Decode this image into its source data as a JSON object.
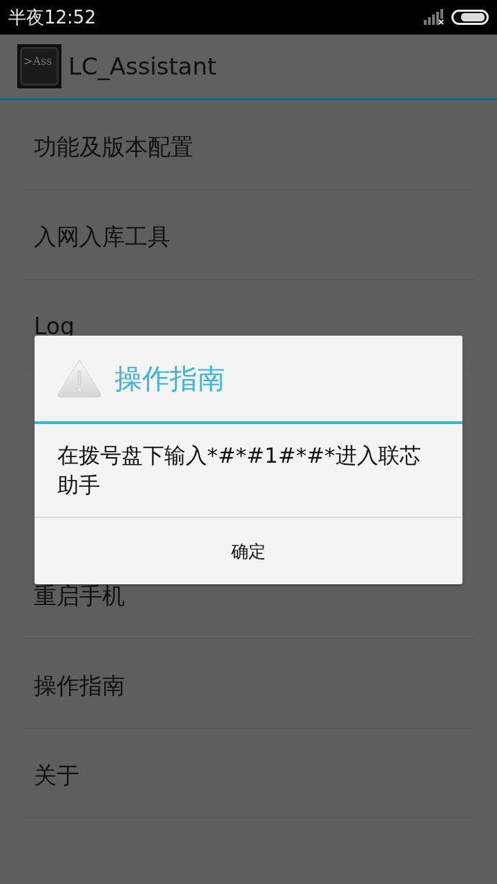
{
  "status_bar": {
    "time": "半夜12:52"
  },
  "action_bar": {
    "icon_text": ">Ass",
    "title": "LC_Assistant"
  },
  "menu_items": [
    {
      "label": "功能及版本配置"
    },
    {
      "label": "入网入库工具"
    },
    {
      "label": "Log"
    },
    {
      "label": "重启手机"
    },
    {
      "label": "操作指南"
    },
    {
      "label": "关于"
    }
  ],
  "dialog": {
    "title": "操作指南",
    "message": "在拨号盘下输入*#*#1#*#*进入联芯助手",
    "buttons": [
      "确定"
    ]
  }
}
